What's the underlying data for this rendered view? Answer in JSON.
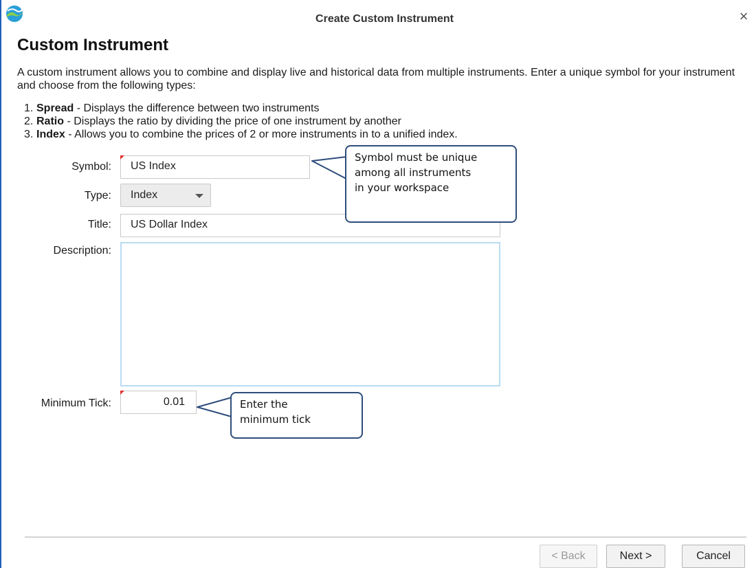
{
  "window": {
    "title": "Create Custom Instrument",
    "close_symbol": "×",
    "logo_icon": "app-logo-icon"
  },
  "heading": "Custom Instrument",
  "intro": "A custom instrument allows you to combine and display live and historical data from multiple instruments. Enter a unique symbol for your instrument and choose from the following types:",
  "types": [
    {
      "num": "1.",
      "name": "Spread",
      "desc": " - Displays the difference between two instruments"
    },
    {
      "num": "2.",
      "name": "Ratio",
      "desc": " - Displays the ratio by dividing the price of one instrument by another"
    },
    {
      "num": "3.",
      "name": "Index",
      "desc": " - Allows you to combine the prices of 2 or more instruments in to a unified index."
    }
  ],
  "form": {
    "symbol_label": "Symbol:",
    "symbol_value": "US Index",
    "type_label": "Type:",
    "type_value": "Index",
    "title_label": "Title:",
    "title_value": "US Dollar Index",
    "description_label": "Description:",
    "description_value": "",
    "min_tick_label": "Minimum Tick:",
    "min_tick_value": "0.01"
  },
  "callouts": {
    "symbol": [
      "Symbol must be unique",
      "among all instruments",
      "in your workspace"
    ],
    "tick": [
      "Enter the",
      "minimum tick"
    ]
  },
  "buttons": {
    "back": "< Back",
    "next": "Next >",
    "cancel": "Cancel"
  },
  "colors": {
    "window_border": "#1f5fb8",
    "required_marker": "#e03030",
    "callout_border": "#2e4d7b",
    "description_border": "#b9dcf2"
  }
}
